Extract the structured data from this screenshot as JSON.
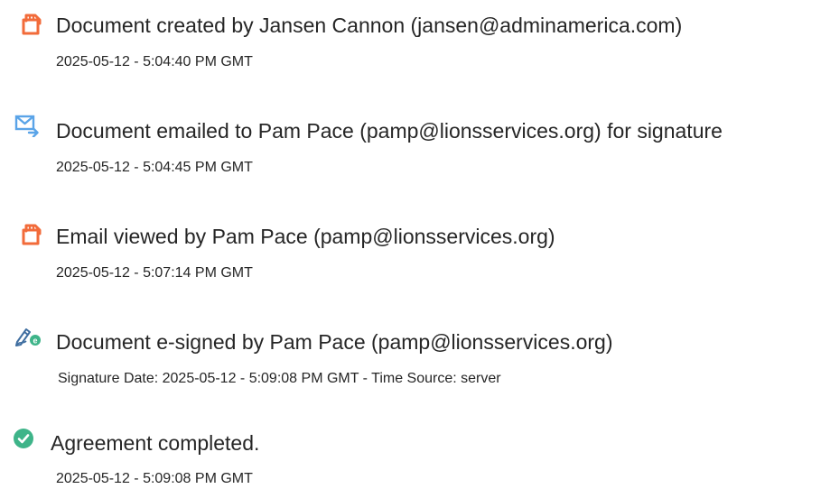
{
  "events": [
    {
      "icon": "document-created-icon",
      "title": "Document created by Jansen Cannon (jansen@adminamerica.com)",
      "timestamp": "2025-05-12 - 5:04:40 PM GMT"
    },
    {
      "icon": "email-sent-icon",
      "title": "Document emailed to Pam Pace (pamp@lionsservices.org) for signature",
      "timestamp": "2025-05-12 - 5:04:45 PM GMT"
    },
    {
      "icon": "email-viewed-icon",
      "title": "Email viewed by Pam Pace (pamp@lionsservices.org)",
      "timestamp": "2025-05-12 - 5:07:14 PM GMT"
    },
    {
      "icon": "e-sign-pen-icon",
      "title": "Document e-signed by Pam Pace (pamp@lionsservices.org)",
      "timestamp": "Signature Date: 2025-05-12 - 5:09:08 PM GMT - Time Source: server"
    },
    {
      "icon": "completed-check-icon",
      "title": "Agreement completed.",
      "timestamp": "2025-05-12 - 5:09:08 PM GMT"
    }
  ],
  "colors": {
    "document_icon": "#F26B3A",
    "email_icon": "#5AA4E8",
    "check_icon": "#3EB489",
    "text": "#262626"
  }
}
